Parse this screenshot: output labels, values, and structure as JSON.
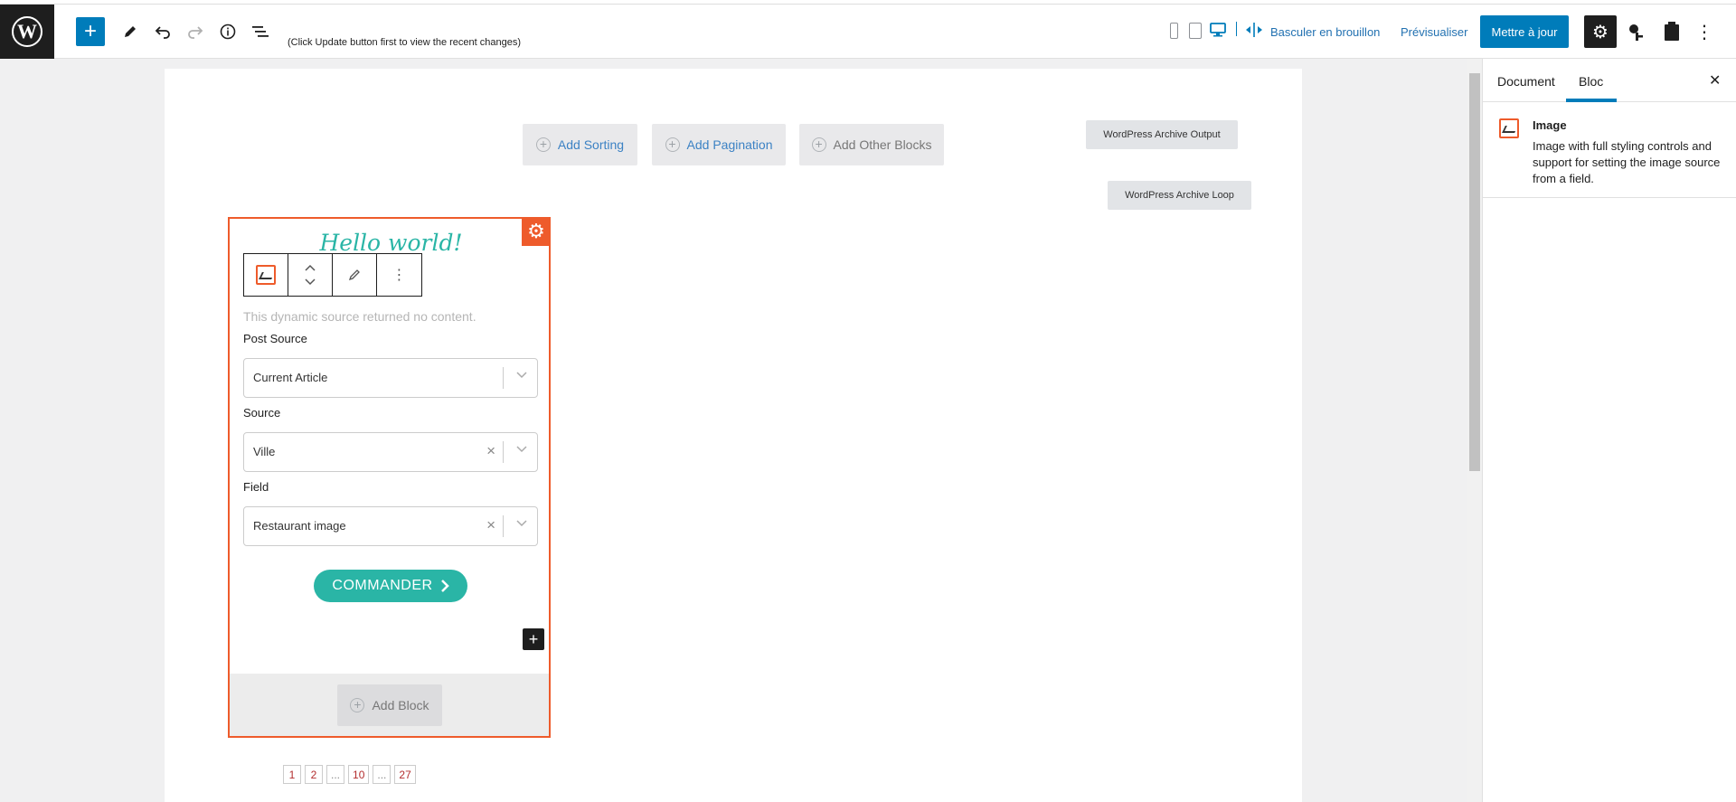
{
  "topbar": {
    "logo": "W",
    "add_icon": "+",
    "note": "(Click Update button first to view the recent changes)",
    "switch_draft": "Basculer en brouillon",
    "preview": "Prévisualiser",
    "update": "Mettre à jour"
  },
  "canvas": {
    "add_sorting": "Add Sorting",
    "add_pagination": "Add Pagination",
    "add_other_blocks": "Add Other Blocks",
    "archive_output": "WordPress Archive Output",
    "archive_loop": "WordPress Archive Loop",
    "card": {
      "heading": "Hello world!",
      "no_content": "This dynamic source returned no content.",
      "post_source_label": "Post Source",
      "post_source_value": "Current Article",
      "source_label": "Source",
      "source_value": "Ville",
      "field_label": "Field",
      "field_value": "Restaurant image",
      "cta_label": "COMMANDER",
      "add_block": "Add Block"
    },
    "pagination": [
      "1",
      "2",
      "...",
      "10",
      "...",
      "27"
    ]
  },
  "sidebar": {
    "tab_document": "Document",
    "tab_block": "Bloc",
    "block_title": "Image",
    "block_description": "Image with full styling controls and support for setting the image source from a field."
  },
  "colors": {
    "accent": "#007cba",
    "block_border": "#ee5b2b",
    "teal": "#2ab5a6"
  }
}
